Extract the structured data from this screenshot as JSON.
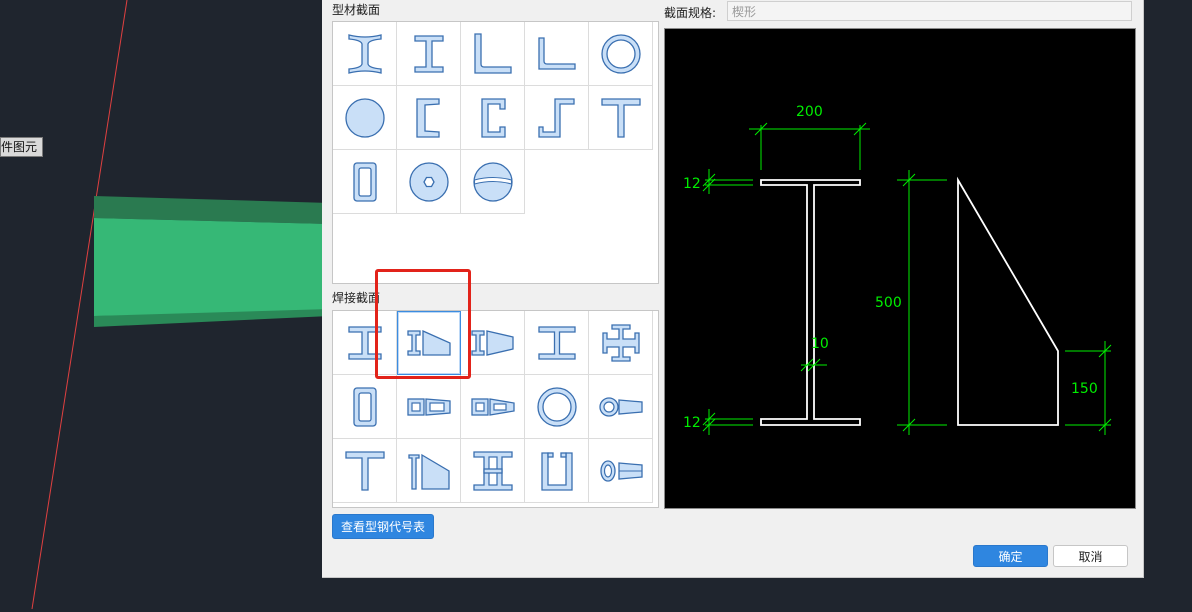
{
  "background": {
    "tooltip_text": "件图元",
    "colors": {
      "viewport": "#1f252e",
      "beam_top": "#2a7a50",
      "beam_face": "#36b876",
      "guide_line": "#e04040"
    }
  },
  "dialog": {
    "profile_section_label": "型材截面",
    "welded_section_label": "焊接截面",
    "spec_label": "截面规格:",
    "spec_value": "楔形",
    "view_table_button": "查看型钢代号表",
    "confirm_button": "确定",
    "cancel_button": "取消",
    "profile_shapes": [
      "i-beam-icon",
      "h-beam-icon",
      "equal-angle-icon",
      "unequal-angle-icon",
      "pipe-icon",
      "round-bar-icon",
      "channel-icon",
      "lipped-channel-icon",
      "z-section-icon",
      "t-section-icon",
      "rect-tube-icon",
      "hex-bolt-icon",
      "sphere-icon"
    ],
    "welded_shapes": [
      "welded-h-icon",
      "tapered-h-icon",
      "double-tapered-h-icon",
      "welded-i-icon",
      "cross-section-icon",
      "welded-box-icon",
      "tapered-box-icon",
      "double-box-icon",
      "welded-pipe-icon",
      "tapered-pipe-icon",
      "welded-t-icon",
      "tapered-t-icon",
      "double-h-icon",
      "u-section-icon",
      "tapered-cone-icon"
    ],
    "selected_welded_index": 1
  },
  "preview": {
    "dim_top_width": "200",
    "dim_flange_top": "12",
    "dim_height": "500",
    "dim_web": "10",
    "dim_flange_bottom": "12",
    "dim_end_height": "150",
    "colors": {
      "background": "#000000",
      "outline": "#ffffff",
      "dimension": "#00ee00"
    }
  }
}
